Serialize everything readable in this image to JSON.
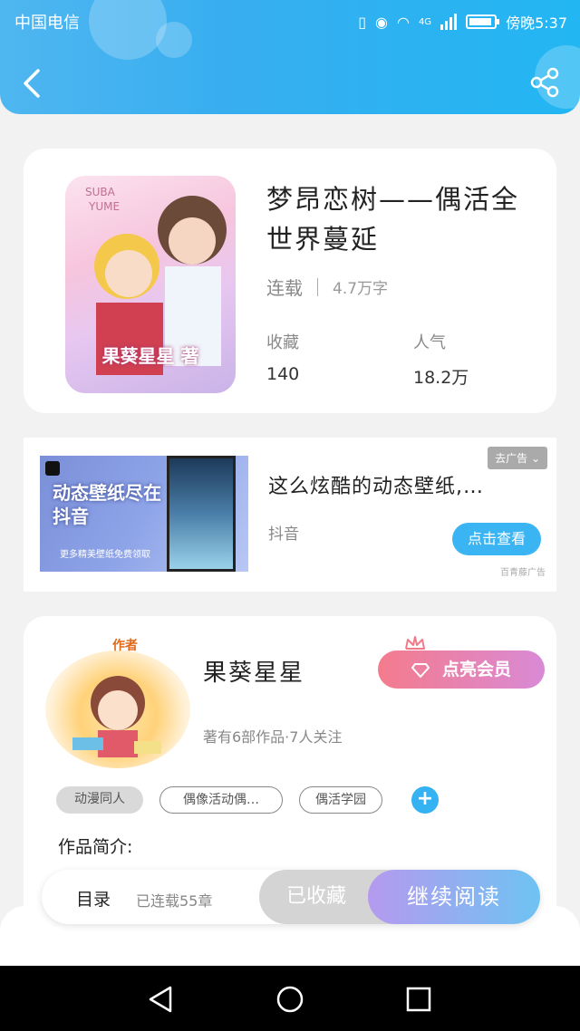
{
  "status_bar": {
    "carrier": "中国电信",
    "network": "4G",
    "time": "傍晚5:37"
  },
  "header": {
    "back_icon": "chevron-left-icon",
    "share_icon": "share-icon"
  },
  "book": {
    "title": "梦昂恋树——偶活全世界蔓延",
    "cover_text": "果葵星星 著",
    "status": "连载",
    "word_count": "4.7万字",
    "stats": [
      {
        "label": "收藏",
        "value": "140"
      },
      {
        "label": "人气",
        "value": "18.2万"
      }
    ]
  },
  "ad": {
    "image_text": "动态壁纸尽在抖音",
    "image_subtext": "更多精美壁纸免费领取",
    "title": "这么炫酷的动态壁纸,…",
    "source": "抖音",
    "close_label": "去广告",
    "cta_label": "点击查看",
    "badge": "百青藤广告"
  },
  "author": {
    "tag": "作者",
    "name": "果葵星星",
    "meta": "著有6部作品·7人关注",
    "vip_label": "点亮会员",
    "tags": [
      "动漫同人",
      "偶像活动偶…",
      "偶活学园"
    ],
    "intro_label": "作品简介:"
  },
  "action_bar": {
    "toc_label": "目录",
    "toc_status": "已连载55章",
    "collected_label": "已收藏",
    "read_label": "继续阅读"
  },
  "colors": {
    "header_blue": "#37aef0",
    "accent_blue": "#35b2f2",
    "vip_pink": "#f47b8c",
    "read_purple": "#b59aef"
  }
}
